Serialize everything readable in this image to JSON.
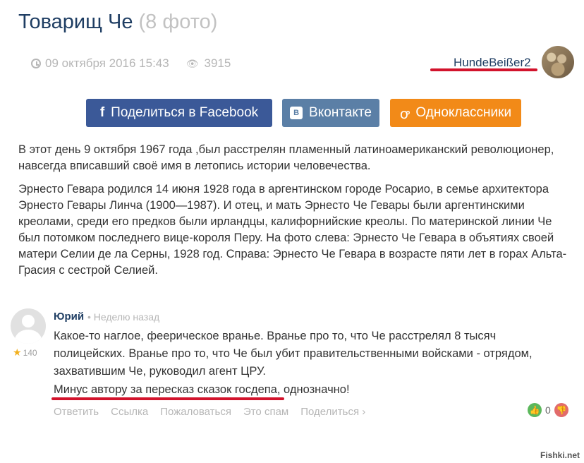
{
  "post": {
    "title": "Товарищ Че",
    "photo_count": "(8 фото)",
    "date": "09 октября 2016 15:43",
    "views": "3915",
    "author": "HundeBeißer2"
  },
  "share": {
    "facebook": "Поделиться в Facebook",
    "vkontakte": "Вконтакте",
    "odnoklassniki": "Одноклассники"
  },
  "article": {
    "p1": "В этот день 9 октября 1967 года ,был расстрелян пламенный латиноамериканский революционер, навсегда вписавший своё имя в летопись истории человечества.",
    "p2": "Эрнесто Гевара родился 14 июня 1928 года в аргентинском городе Росарио, в семье архитектора Эрнесто Гевары Линча (1900—1987). И отец, и мать Эрнесто Че Гевары были аргентинскими креолами, среди его предков были ирландцы, калифорнийские креолы. По материнской линии Че был потомком последнего вице-короля Перу. На фото слева: Эрнесто Че Гевара в объятиях своей матери Селии де ла Серны, 1928 год. Справа: Эрнесто Че Гевара в возрасте пяти лет в горах Альта-Грасия с сестрой Селией."
  },
  "comment": {
    "author": "Юрий",
    "time": "• Неделю назад",
    "rating": "140",
    "text": "Какое-то наглое, феерическое вранье. Вранье про то, что Че расстрелял 8 тысяч полицейских. Вранье про то, что Че был убит правительственными войсками - отрядом, захватившим Че, руководил агент ЦРУ.",
    "last_line_underlined": "Минус автору за пересказ сказок госдепа",
    "last_line_rest": ", однозначно!",
    "actions": {
      "reply": "Ответить",
      "link": "Ссылка",
      "report": "Пожаловаться",
      "spam": "Это спам",
      "share": "Поделиться ›"
    },
    "votes": "0"
  },
  "watermark": "Fishki.net",
  "colors": {
    "title": "#1f3e63",
    "facebook": "#3b5998",
    "vkontakte": "#5b7fa6",
    "odnoklassniki": "#f28a18",
    "annotation_red": "#d2132c"
  }
}
